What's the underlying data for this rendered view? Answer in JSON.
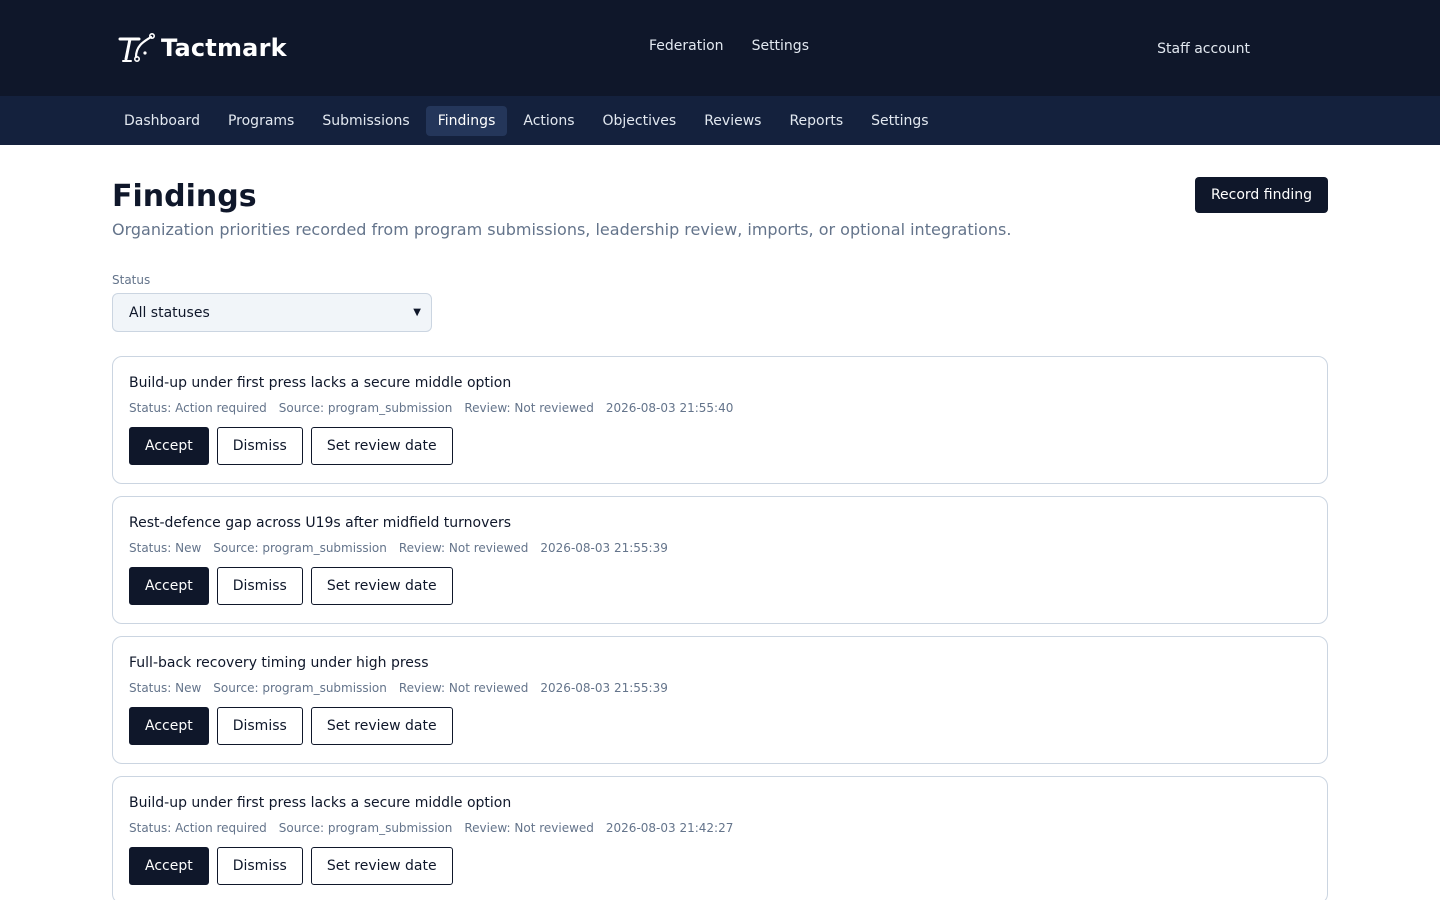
{
  "app": {
    "brand": "Tactmark",
    "top_nav": [
      "Federation",
      "Settings"
    ],
    "account": "Staff account"
  },
  "sub_nav": {
    "items": [
      "Dashboard",
      "Programs",
      "Submissions",
      "Findings",
      "Actions",
      "Objectives",
      "Reviews",
      "Reports",
      "Settings"
    ],
    "active": "Findings"
  },
  "page": {
    "title": "Findings",
    "subtitle": "Organization priorities recorded from program submissions, leadership review, imports, or optional integrations.",
    "record_button": "Record finding"
  },
  "filter": {
    "label": "Status",
    "selected": "All statuses"
  },
  "actions": {
    "accept": "Accept",
    "dismiss": "Dismiss",
    "set_review_date": "Set review date"
  },
  "findings": [
    {
      "title": "Build-up under first press lacks a secure middle option",
      "status": "Status: Action required",
      "source": "Source: program_submission",
      "review": "Review: Not reviewed",
      "timestamp": "2026-08-03 21:55:40"
    },
    {
      "title": "Rest-defence gap across U19s after midfield turnovers",
      "status": "Status: New",
      "source": "Source: program_submission",
      "review": "Review: Not reviewed",
      "timestamp": "2026-08-03 21:55:39"
    },
    {
      "title": "Full-back recovery timing under high press",
      "status": "Status: New",
      "source": "Source: program_submission",
      "review": "Review: Not reviewed",
      "timestamp": "2026-08-03 21:55:39"
    },
    {
      "title": "Build-up under first press lacks a secure middle option",
      "status": "Status: Action required",
      "source": "Source: program_submission",
      "review": "Review: Not reviewed",
      "timestamp": "2026-08-03 21:42:27"
    }
  ],
  "colors": {
    "header_bg": "#0f172a",
    "subnav_bg": "#14213d",
    "subnav_active": "#24365a",
    "primary": "#0f172a",
    "muted_text": "#64748b",
    "border": "#cbd5e1"
  }
}
